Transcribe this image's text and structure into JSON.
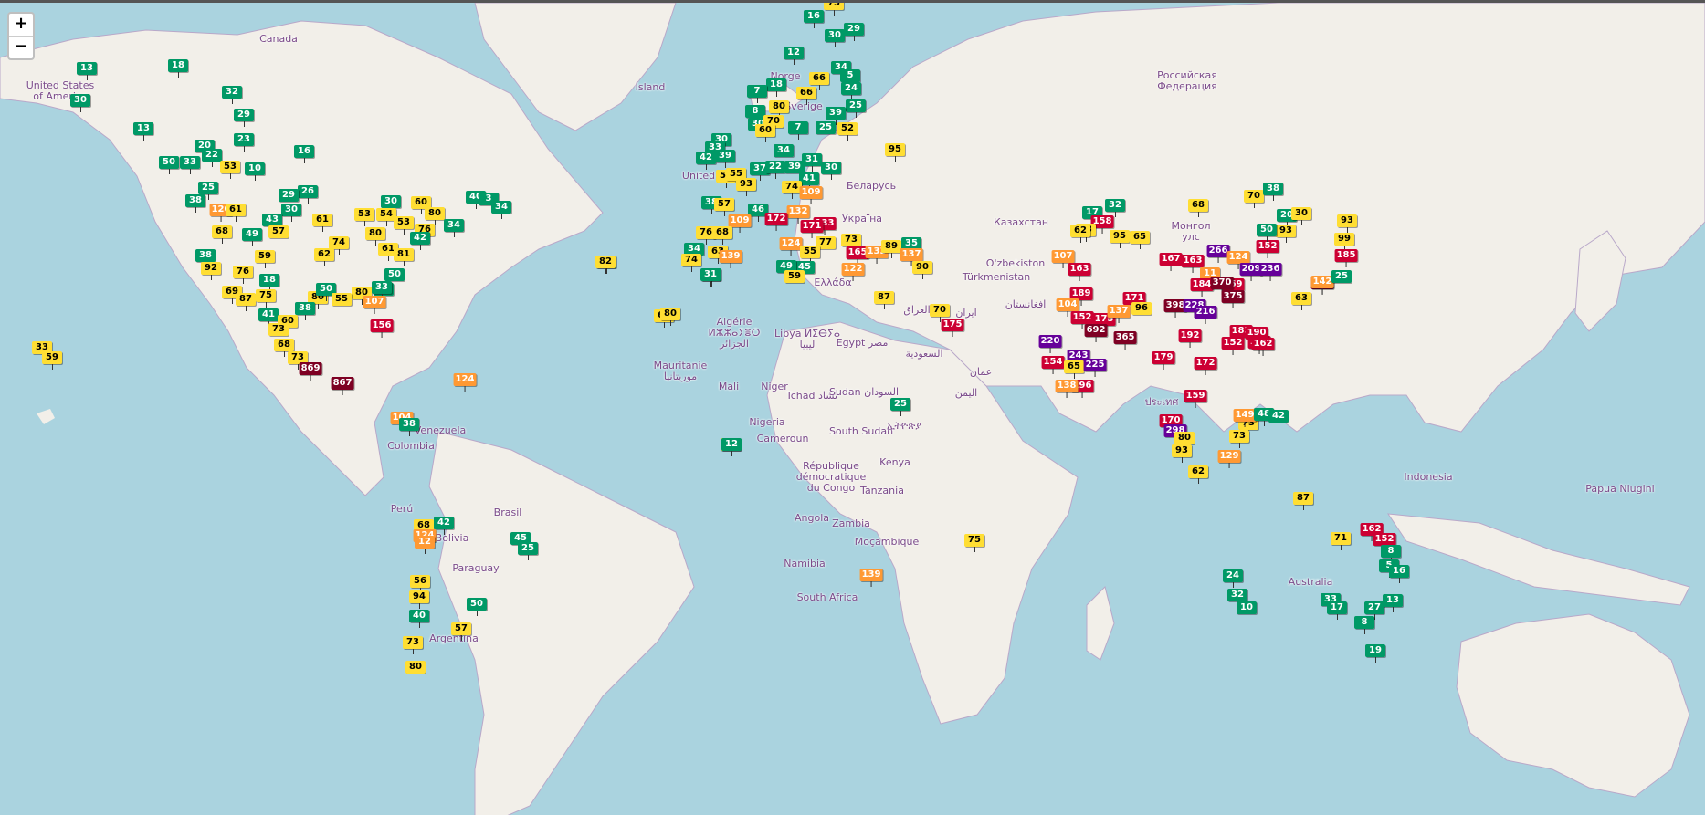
{
  "zoom_control": {
    "in_label": "+",
    "out_label": "−"
  },
  "colors": {
    "water": "#aad3df",
    "land": "#f2efe9",
    "good": "#009966",
    "moderate": "#ffde33",
    "unhealthy_sensitive": "#ff9933",
    "unhealthy": "#cc0033",
    "very_unhealthy": "#660099",
    "hazardous": "#7e0023"
  },
  "map_labels": [
    {
      "text": "Canada"
    },
    {
      "text": "United States\nof America"
    },
    {
      "text": "Российская\nФедерация"
    },
    {
      "text": "Ísland"
    },
    {
      "text": "Norge"
    },
    {
      "text": "Sverige"
    },
    {
      "text": "United"
    },
    {
      "text": "Беларусь"
    },
    {
      "text": "Україна"
    },
    {
      "text": "Казахстан"
    },
    {
      "text": "Монгол\nулс"
    },
    {
      "text": "O'zbekiston"
    },
    {
      "text": "Türkmenistan"
    },
    {
      "text": "افغانستان"
    },
    {
      "text": "ایران"
    },
    {
      "text": "العراق"
    },
    {
      "text": "السعودية"
    },
    {
      "text": "عمان"
    },
    {
      "text": "اليمن"
    },
    {
      "text": "Ελλάδα"
    },
    {
      "text": "Algérie\nⵍⵣⵣⴰⵢⴻⵔ\nالجزائر"
    },
    {
      "text": "Libya ⵍⵉⴱⵢⴰ\nليبيا"
    },
    {
      "text": "Egypt مصر"
    },
    {
      "text": "Mauritanie\nموريتانيا"
    },
    {
      "text": "Mali"
    },
    {
      "text": "Niger"
    },
    {
      "text": "Tchad تشاد"
    },
    {
      "text": "Sudan السودان"
    },
    {
      "text": "Nigeria"
    },
    {
      "text": "South Sudan"
    },
    {
      "text": "ኢትዮጵያ"
    },
    {
      "text": "Cameroun"
    },
    {
      "text": "République\ndémocratique\ndu Congo"
    },
    {
      "text": "Kenya"
    },
    {
      "text": "Tanzania"
    },
    {
      "text": "Angola"
    },
    {
      "text": "Zambia"
    },
    {
      "text": "Moçambique"
    },
    {
      "text": "Namibia"
    },
    {
      "text": "South Africa"
    },
    {
      "text": "Venezuela"
    },
    {
      "text": "Colombia"
    },
    {
      "text": "Perú"
    },
    {
      "text": "Brasil"
    },
    {
      "text": "Bolivia"
    },
    {
      "text": "Paraguay"
    },
    {
      "text": "Argentina"
    },
    {
      "text": "Indonesia"
    },
    {
      "text": "Papua Niugini"
    },
    {
      "text": "Australia"
    },
    {
      "text": "ประเทศ"
    }
  ],
  "stations": [
    {
      "v": "75",
      "c": "moderate"
    },
    {
      "v": "16",
      "c": "good"
    },
    {
      "v": "30",
      "c": "good"
    },
    {
      "v": "29",
      "c": "good"
    },
    {
      "v": "12",
      "c": "good"
    },
    {
      "v": "34",
      "c": "good"
    },
    {
      "v": "66",
      "c": "moderate"
    },
    {
      "v": "5",
      "c": "good"
    },
    {
      "v": "18",
      "c": "good"
    },
    {
      "v": "7",
      "c": "good"
    },
    {
      "v": "66",
      "c": "moderate"
    },
    {
      "v": "24",
      "c": "good"
    },
    {
      "v": "80",
      "c": "moderate"
    },
    {
      "v": "25",
      "c": "good"
    },
    {
      "v": "8",
      "c": "good"
    },
    {
      "v": "39",
      "c": "good"
    },
    {
      "v": "30",
      "c": "good"
    },
    {
      "v": "70",
      "c": "moderate"
    },
    {
      "v": "60",
      "c": "moderate"
    },
    {
      "v": "7",
      "c": "good"
    },
    {
      "v": "25",
      "c": "good"
    },
    {
      "v": "52",
      "c": "moderate"
    },
    {
      "v": "95",
      "c": "moderate"
    },
    {
      "v": "30",
      "c": "good"
    },
    {
      "v": "33",
      "c": "good"
    },
    {
      "v": "34",
      "c": "good"
    },
    {
      "v": "42",
      "c": "good"
    },
    {
      "v": "39",
      "c": "good"
    },
    {
      "v": "31",
      "c": "good"
    },
    {
      "v": "53",
      "c": "moderate"
    },
    {
      "v": "55",
      "c": "moderate"
    },
    {
      "v": "93",
      "c": "moderate"
    },
    {
      "v": "37",
      "c": "good"
    },
    {
      "v": "22",
      "c": "good"
    },
    {
      "v": "39",
      "c": "good"
    },
    {
      "v": "30",
      "c": "good"
    },
    {
      "v": "41",
      "c": "good"
    },
    {
      "v": "74",
      "c": "moderate"
    },
    {
      "v": "109",
      "c": "unhealthy_sensitive"
    },
    {
      "v": "38",
      "c": "good"
    },
    {
      "v": "57",
      "c": "moderate"
    },
    {
      "v": "46",
      "c": "good"
    },
    {
      "v": "132",
      "c": "unhealthy_sensitive"
    },
    {
      "v": "109",
      "c": "unhealthy_sensitive"
    },
    {
      "v": "172",
      "c": "unhealthy"
    },
    {
      "v": "133",
      "c": "unhealthy"
    },
    {
      "v": "171",
      "c": "unhealthy"
    },
    {
      "v": "76",
      "c": "moderate"
    },
    {
      "v": "68",
      "c": "moderate"
    },
    {
      "v": "124",
      "c": "unhealthy_sensitive"
    },
    {
      "v": "77",
      "c": "moderate"
    },
    {
      "v": "73",
      "c": "moderate"
    },
    {
      "v": "34",
      "c": "good"
    },
    {
      "v": "63",
      "c": "moderate"
    },
    {
      "v": "139",
      "c": "unhealthy_sensitive"
    },
    {
      "v": "55",
      "c": "moderate"
    },
    {
      "v": "165",
      "c": "unhealthy"
    },
    {
      "v": "133",
      "c": "unhealthy_sensitive"
    },
    {
      "v": "89",
      "c": "moderate"
    },
    {
      "v": "35",
      "c": "good"
    },
    {
      "v": "137",
      "c": "unhealthy_sensitive"
    },
    {
      "v": "74",
      "c": "moderate"
    },
    {
      "v": "10",
      "c": "good"
    },
    {
      "v": "45",
      "c": "good"
    },
    {
      "v": "49",
      "c": "good"
    },
    {
      "v": "122",
      "c": "unhealthy_sensitive"
    },
    {
      "v": "90",
      "c": "moderate"
    },
    {
      "v": "31",
      "c": "good"
    },
    {
      "v": "59",
      "c": "moderate"
    },
    {
      "v": "87",
      "c": "moderate"
    },
    {
      "v": "42",
      "c": "good"
    },
    {
      "v": "68",
      "c": "moderate"
    },
    {
      "v": "70",
      "c": "moderate"
    },
    {
      "v": "175",
      "c": "unhealthy"
    },
    {
      "v": "25",
      "c": "good"
    },
    {
      "v": "70",
      "c": "moderate"
    },
    {
      "v": "13",
      "c": "good"
    },
    {
      "v": "18",
      "c": "good"
    },
    {
      "v": "30",
      "c": "good"
    },
    {
      "v": "32",
      "c": "good"
    },
    {
      "v": "29",
      "c": "good"
    },
    {
      "v": "13",
      "c": "good"
    },
    {
      "v": "23",
      "c": "good"
    },
    {
      "v": "20",
      "c": "good"
    },
    {
      "v": "22",
      "c": "good"
    },
    {
      "v": "50",
      "c": "good"
    },
    {
      "v": "33",
      "c": "good"
    },
    {
      "v": "53",
      "c": "moderate"
    },
    {
      "v": "10",
      "c": "good"
    },
    {
      "v": "16",
      "c": "good"
    },
    {
      "v": "25",
      "c": "good"
    },
    {
      "v": "38",
      "c": "good"
    },
    {
      "v": "120",
      "c": "unhealthy_sensitive"
    },
    {
      "v": "61",
      "c": "moderate"
    },
    {
      "v": "26",
      "c": "good"
    },
    {
      "v": "29",
      "c": "good"
    },
    {
      "v": "30",
      "c": "good"
    },
    {
      "v": "60",
      "c": "moderate"
    },
    {
      "v": "30",
      "c": "good"
    },
    {
      "v": "80",
      "c": "moderate"
    },
    {
      "v": "53",
      "c": "moderate"
    },
    {
      "v": "54",
      "c": "moderate"
    },
    {
      "v": "68",
      "c": "moderate"
    },
    {
      "v": "49",
      "c": "good"
    },
    {
      "v": "43",
      "c": "good"
    },
    {
      "v": "57",
      "c": "moderate"
    },
    {
      "v": "61",
      "c": "moderate"
    },
    {
      "v": "74",
      "c": "moderate"
    },
    {
      "v": "80",
      "c": "moderate"
    },
    {
      "v": "53",
      "c": "moderate"
    },
    {
      "v": "76",
      "c": "moderate"
    },
    {
      "v": "42",
      "c": "good"
    },
    {
      "v": "34",
      "c": "good"
    },
    {
      "v": "40",
      "c": "good"
    },
    {
      "v": "3",
      "c": "good"
    },
    {
      "v": "34",
      "c": "good"
    },
    {
      "v": "38",
      "c": "good"
    },
    {
      "v": "59",
      "c": "moderate"
    },
    {
      "v": "62",
      "c": "moderate"
    },
    {
      "v": "61",
      "c": "moderate"
    },
    {
      "v": "81",
      "c": "moderate"
    },
    {
      "v": "92",
      "c": "moderate"
    },
    {
      "v": "76",
      "c": "moderate"
    },
    {
      "v": "69",
      "c": "moderate"
    },
    {
      "v": "18",
      "c": "good"
    },
    {
      "v": "50",
      "c": "good"
    },
    {
      "v": "36",
      "c": "good"
    },
    {
      "v": "80",
      "c": "moderate"
    },
    {
      "v": "80",
      "c": "moderate"
    },
    {
      "v": "50",
      "c": "good"
    },
    {
      "v": "33",
      "c": "good"
    },
    {
      "v": "87",
      "c": "moderate"
    },
    {
      "v": "75",
      "c": "moderate"
    },
    {
      "v": "55",
      "c": "moderate"
    },
    {
      "v": "107",
      "c": "unhealthy_sensitive"
    },
    {
      "v": "38",
      "c": "good"
    },
    {
      "v": "41",
      "c": "good"
    },
    {
      "v": "60",
      "c": "moderate"
    },
    {
      "v": "73",
      "c": "moderate"
    },
    {
      "v": "68",
      "c": "moderate"
    },
    {
      "v": "73",
      "c": "moderate"
    },
    {
      "v": "869",
      "c": "hazardous"
    },
    {
      "v": "156",
      "c": "unhealthy"
    },
    {
      "v": "867",
      "c": "hazardous"
    },
    {
      "v": "124",
      "c": "unhealthy_sensitive"
    },
    {
      "v": "33",
      "c": "moderate"
    },
    {
      "v": "59",
      "c": "moderate"
    },
    {
      "v": "82",
      "c": "moderate"
    },
    {
      "v": "104",
      "c": "unhealthy_sensitive"
    },
    {
      "v": "38",
      "c": "good"
    },
    {
      "v": "68",
      "c": "moderate"
    },
    {
      "v": "42",
      "c": "good"
    },
    {
      "v": "124",
      "c": "unhealthy_sensitive"
    },
    {
      "v": "12",
      "c": "unhealthy_sensitive"
    },
    {
      "v": "45",
      "c": "good"
    },
    {
      "v": "25",
      "c": "good"
    },
    {
      "v": "56",
      "c": "moderate"
    },
    {
      "v": "94",
      "c": "moderate"
    },
    {
      "v": "40",
      "c": "good"
    },
    {
      "v": "50",
      "c": "good"
    },
    {
      "v": "57",
      "c": "moderate"
    },
    {
      "v": "73",
      "c": "moderate"
    },
    {
      "v": "80",
      "c": "moderate"
    },
    {
      "v": "80",
      "c": "moderate"
    },
    {
      "v": "12",
      "c": "good"
    },
    {
      "v": "139",
      "c": "unhealthy_sensitive"
    },
    {
      "v": "75",
      "c": "moderate"
    },
    {
      "v": "68",
      "c": "moderate"
    },
    {
      "v": "70",
      "c": "moderate"
    },
    {
      "v": "32",
      "c": "good"
    },
    {
      "v": "17",
      "c": "good"
    },
    {
      "v": "158",
      "c": "unhealthy"
    },
    {
      "v": "53",
      "c": "moderate"
    },
    {
      "v": "95",
      "c": "moderate"
    },
    {
      "v": "65",
      "c": "moderate"
    },
    {
      "v": "62",
      "c": "moderate"
    },
    {
      "v": "107",
      "c": "unhealthy_sensitive"
    },
    {
      "v": "163",
      "c": "unhealthy"
    },
    {
      "v": "189",
      "c": "unhealthy"
    },
    {
      "v": "104",
      "c": "unhealthy_sensitive"
    },
    {
      "v": "152",
      "c": "unhealthy"
    },
    {
      "v": "175",
      "c": "unhealthy"
    },
    {
      "v": "171",
      "c": "unhealthy"
    },
    {
      "v": "137",
      "c": "unhealthy_sensitive"
    },
    {
      "v": "96",
      "c": "moderate"
    },
    {
      "v": "692",
      "c": "hazardous"
    },
    {
      "v": "365",
      "c": "hazardous"
    },
    {
      "v": "220",
      "c": "very_unhealthy"
    },
    {
      "v": "243",
      "c": "very_unhealthy"
    },
    {
      "v": "154",
      "c": "unhealthy"
    },
    {
      "v": "65",
      "c": "moderate"
    },
    {
      "v": "225",
      "c": "very_unhealthy"
    },
    {
      "v": "196",
      "c": "unhealthy"
    },
    {
      "v": "138",
      "c": "unhealthy_sensitive"
    },
    {
      "v": "167",
      "c": "unhealthy"
    },
    {
      "v": "163",
      "c": "unhealthy"
    },
    {
      "v": "266",
      "c": "very_unhealthy"
    },
    {
      "v": "124",
      "c": "unhealthy_sensitive"
    },
    {
      "v": "152",
      "c": "unhealthy"
    },
    {
      "v": "11",
      "c": "unhealthy_sensitive"
    },
    {
      "v": "169",
      "c": "unhealthy"
    },
    {
      "v": "209",
      "c": "very_unhealthy"
    },
    {
      "v": "184",
      "c": "unhealthy"
    },
    {
      "v": "370",
      "c": "hazardous"
    },
    {
      "v": "375",
      "c": "hazardous"
    },
    {
      "v": "236",
      "c": "very_unhealthy"
    },
    {
      "v": "396",
      "c": "hazardous"
    },
    {
      "v": "398",
      "c": "hazardous"
    },
    {
      "v": "228",
      "c": "very_unhealthy"
    },
    {
      "v": "216",
      "c": "very_unhealthy"
    },
    {
      "v": "192",
      "c": "unhealthy"
    },
    {
      "v": "185",
      "c": "unhealthy"
    },
    {
      "v": "162",
      "c": "unhealthy"
    },
    {
      "v": "152",
      "c": "unhealthy"
    },
    {
      "v": "190",
      "c": "unhealthy"
    },
    {
      "v": "162",
      "c": "unhealthy"
    },
    {
      "v": "179",
      "c": "unhealthy"
    },
    {
      "v": "172",
      "c": "unhealthy"
    },
    {
      "v": "159",
      "c": "unhealthy"
    },
    {
      "v": "170",
      "c": "unhealthy"
    },
    {
      "v": "298",
      "c": "very_unhealthy"
    },
    {
      "v": "80",
      "c": "moderate"
    },
    {
      "v": "93",
      "c": "moderate"
    },
    {
      "v": "62",
      "c": "moderate"
    },
    {
      "v": "73",
      "c": "moderate"
    },
    {
      "v": "149",
      "c": "unhealthy_sensitive"
    },
    {
      "v": "73",
      "c": "moderate"
    },
    {
      "v": "129",
      "c": "unhealthy_sensitive"
    },
    {
      "v": "48",
      "c": "good"
    },
    {
      "v": "42",
      "c": "good"
    },
    {
      "v": "38",
      "c": "good"
    },
    {
      "v": "20",
      "c": "good"
    },
    {
      "v": "93",
      "c": "moderate"
    },
    {
      "v": "30",
      "c": "moderate"
    },
    {
      "v": "50",
      "c": "good"
    },
    {
      "v": "93",
      "c": "moderate"
    },
    {
      "v": "99",
      "c": "moderate"
    },
    {
      "v": "185",
      "c": "unhealthy"
    },
    {
      "v": "142",
      "c": "unhealthy_sensitive"
    },
    {
      "v": "25",
      "c": "good"
    },
    {
      "v": "63",
      "c": "moderate"
    },
    {
      "v": "87",
      "c": "moderate"
    },
    {
      "v": "162",
      "c": "unhealthy"
    },
    {
      "v": "152",
      "c": "unhealthy"
    },
    {
      "v": "71",
      "c": "moderate"
    },
    {
      "v": "8",
      "c": "good"
    },
    {
      "v": "5",
      "c": "good"
    },
    {
      "v": "16",
      "c": "good"
    },
    {
      "v": "24",
      "c": "good"
    },
    {
      "v": "32",
      "c": "good"
    },
    {
      "v": "10",
      "c": "good"
    },
    {
      "v": "33",
      "c": "good"
    },
    {
      "v": "17",
      "c": "good"
    },
    {
      "v": "27",
      "c": "good"
    },
    {
      "v": "13",
      "c": "good"
    },
    {
      "v": "8",
      "c": "good"
    },
    {
      "v": "19",
      "c": "good"
    },
    {
      "v": "13",
      "c": "good"
    },
    {
      "v": "33",
      "c": "good"
    },
    {
      "v": "50",
      "c": "good"
    },
    {
      "v": "28",
      "c": "good"
    }
  ]
}
